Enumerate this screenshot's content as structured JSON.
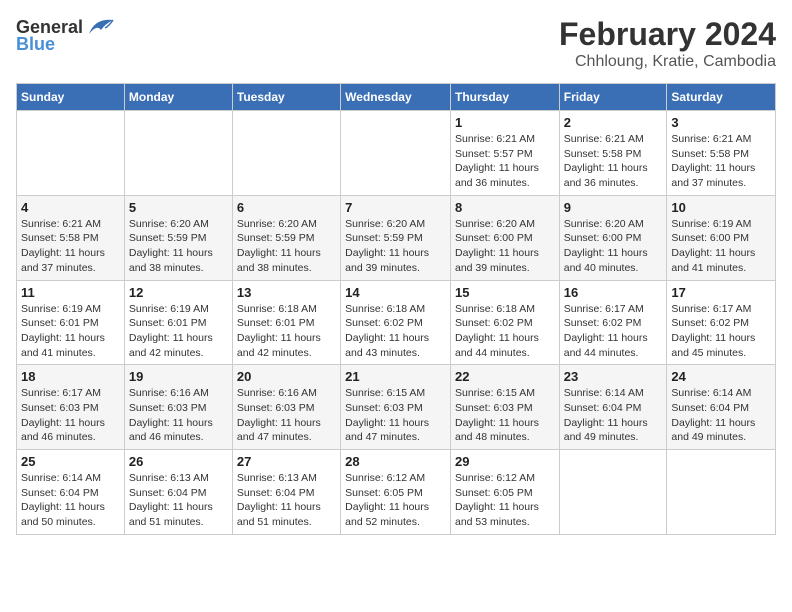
{
  "header": {
    "logo_general": "General",
    "logo_blue": "Blue",
    "title": "February 2024",
    "subtitle": "Chhloung, Kratie, Cambodia"
  },
  "weekdays": [
    "Sunday",
    "Monday",
    "Tuesday",
    "Wednesday",
    "Thursday",
    "Friday",
    "Saturday"
  ],
  "weeks": [
    [
      {
        "day": "",
        "info": ""
      },
      {
        "day": "",
        "info": ""
      },
      {
        "day": "",
        "info": ""
      },
      {
        "day": "",
        "info": ""
      },
      {
        "day": "1",
        "info": "Sunrise: 6:21 AM\nSunset: 5:57 PM\nDaylight: 11 hours\nand 36 minutes."
      },
      {
        "day": "2",
        "info": "Sunrise: 6:21 AM\nSunset: 5:58 PM\nDaylight: 11 hours\nand 36 minutes."
      },
      {
        "day": "3",
        "info": "Sunrise: 6:21 AM\nSunset: 5:58 PM\nDaylight: 11 hours\nand 37 minutes."
      }
    ],
    [
      {
        "day": "4",
        "info": "Sunrise: 6:21 AM\nSunset: 5:58 PM\nDaylight: 11 hours\nand 37 minutes."
      },
      {
        "day": "5",
        "info": "Sunrise: 6:20 AM\nSunset: 5:59 PM\nDaylight: 11 hours\nand 38 minutes."
      },
      {
        "day": "6",
        "info": "Sunrise: 6:20 AM\nSunset: 5:59 PM\nDaylight: 11 hours\nand 38 minutes."
      },
      {
        "day": "7",
        "info": "Sunrise: 6:20 AM\nSunset: 5:59 PM\nDaylight: 11 hours\nand 39 minutes."
      },
      {
        "day": "8",
        "info": "Sunrise: 6:20 AM\nSunset: 6:00 PM\nDaylight: 11 hours\nand 39 minutes."
      },
      {
        "day": "9",
        "info": "Sunrise: 6:20 AM\nSunset: 6:00 PM\nDaylight: 11 hours\nand 40 minutes."
      },
      {
        "day": "10",
        "info": "Sunrise: 6:19 AM\nSunset: 6:00 PM\nDaylight: 11 hours\nand 41 minutes."
      }
    ],
    [
      {
        "day": "11",
        "info": "Sunrise: 6:19 AM\nSunset: 6:01 PM\nDaylight: 11 hours\nand 41 minutes."
      },
      {
        "day": "12",
        "info": "Sunrise: 6:19 AM\nSunset: 6:01 PM\nDaylight: 11 hours\nand 42 minutes."
      },
      {
        "day": "13",
        "info": "Sunrise: 6:18 AM\nSunset: 6:01 PM\nDaylight: 11 hours\nand 42 minutes."
      },
      {
        "day": "14",
        "info": "Sunrise: 6:18 AM\nSunset: 6:02 PM\nDaylight: 11 hours\nand 43 minutes."
      },
      {
        "day": "15",
        "info": "Sunrise: 6:18 AM\nSunset: 6:02 PM\nDaylight: 11 hours\nand 44 minutes."
      },
      {
        "day": "16",
        "info": "Sunrise: 6:17 AM\nSunset: 6:02 PM\nDaylight: 11 hours\nand 44 minutes."
      },
      {
        "day": "17",
        "info": "Sunrise: 6:17 AM\nSunset: 6:02 PM\nDaylight: 11 hours\nand 45 minutes."
      }
    ],
    [
      {
        "day": "18",
        "info": "Sunrise: 6:17 AM\nSunset: 6:03 PM\nDaylight: 11 hours\nand 46 minutes."
      },
      {
        "day": "19",
        "info": "Sunrise: 6:16 AM\nSunset: 6:03 PM\nDaylight: 11 hours\nand 46 minutes."
      },
      {
        "day": "20",
        "info": "Sunrise: 6:16 AM\nSunset: 6:03 PM\nDaylight: 11 hours\nand 47 minutes."
      },
      {
        "day": "21",
        "info": "Sunrise: 6:15 AM\nSunset: 6:03 PM\nDaylight: 11 hours\nand 47 minutes."
      },
      {
        "day": "22",
        "info": "Sunrise: 6:15 AM\nSunset: 6:03 PM\nDaylight: 11 hours\nand 48 minutes."
      },
      {
        "day": "23",
        "info": "Sunrise: 6:14 AM\nSunset: 6:04 PM\nDaylight: 11 hours\nand 49 minutes."
      },
      {
        "day": "24",
        "info": "Sunrise: 6:14 AM\nSunset: 6:04 PM\nDaylight: 11 hours\nand 49 minutes."
      }
    ],
    [
      {
        "day": "25",
        "info": "Sunrise: 6:14 AM\nSunset: 6:04 PM\nDaylight: 11 hours\nand 50 minutes."
      },
      {
        "day": "26",
        "info": "Sunrise: 6:13 AM\nSunset: 6:04 PM\nDaylight: 11 hours\nand 51 minutes."
      },
      {
        "day": "27",
        "info": "Sunrise: 6:13 AM\nSunset: 6:04 PM\nDaylight: 11 hours\nand 51 minutes."
      },
      {
        "day": "28",
        "info": "Sunrise: 6:12 AM\nSunset: 6:05 PM\nDaylight: 11 hours\nand 52 minutes."
      },
      {
        "day": "29",
        "info": "Sunrise: 6:12 AM\nSunset: 6:05 PM\nDaylight: 11 hours\nand 53 minutes."
      },
      {
        "day": "",
        "info": ""
      },
      {
        "day": "",
        "info": ""
      }
    ]
  ]
}
